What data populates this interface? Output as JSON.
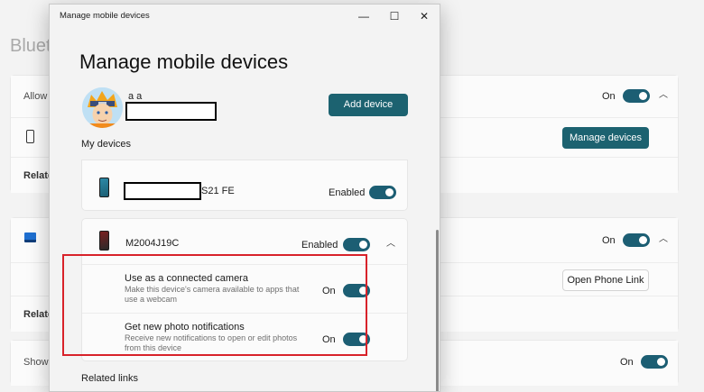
{
  "background": {
    "page_title": "Bluet",
    "allow_label": "Allow",
    "allow_state": "On",
    "related_label_1": "Relate",
    "manage_devices_button": "Manage devices",
    "phone_link_state": "On",
    "related_label_2": "Relate",
    "open_phone_link_button": "Open Phone Link",
    "show_label": "Show n",
    "show_state": "On"
  },
  "dialog": {
    "window_title": "Manage mobile devices",
    "heading": "Manage mobile devices",
    "user_name": "a a",
    "add_device_button": "Add device",
    "my_devices_label": "My devices",
    "related_links_label": "Related links",
    "devices": [
      {
        "name_suffix": "S21 FE",
        "status": "Enabled",
        "enabled": true
      },
      {
        "name": "M2004J19C",
        "status": "Enabled",
        "enabled": true,
        "expanded": true,
        "settings": [
          {
            "title": "Use as a connected camera",
            "description": "Make this device's camera available to apps that use a webcam",
            "state": "On",
            "on": true
          },
          {
            "title": "Get new photo notifications",
            "description": "Receive new notifications to open or edit photos from this device",
            "state": "On",
            "on": true
          }
        ]
      }
    ]
  },
  "colors": {
    "accent": "#1c5e73",
    "highlight": "#d8222a"
  }
}
